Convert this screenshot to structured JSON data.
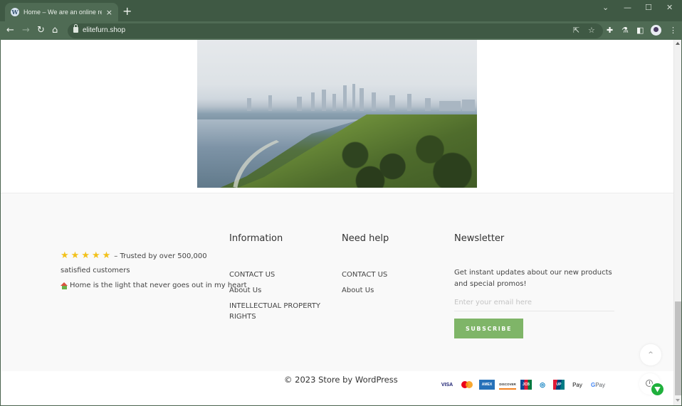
{
  "browser": {
    "tab": {
      "favicon": "wordpress-icon",
      "title": "Home – We are an online retail",
      "close_label": "×"
    },
    "new_tab_label": "+",
    "window_controls": {
      "tab_search": "⌄",
      "minimize": "—",
      "maximize": "☐",
      "close": "✕"
    },
    "nav": {
      "back": "←",
      "forward": "→",
      "reload": "↻",
      "home": "⌂"
    },
    "url": "elitefurn.shop",
    "omnibox_icons": {
      "share": "⇱",
      "bookmark": "☆"
    },
    "toolbar_icons": {
      "extensions": "✚",
      "labs": "⚗",
      "side_panel": "◧",
      "menu": "⋮"
    }
  },
  "hero_image": {
    "alt": "Aerial view of city skyline, lake, and park"
  },
  "footer": {
    "about": {
      "rating_stars": 5,
      "stars": [
        "★",
        "★",
        "★",
        "★",
        "★"
      ],
      "trust_line1": "– Trusted by over 500,000",
      "trust_line2": "satisfied customers",
      "motto": "Home is the light that never goes out in my heart"
    },
    "information": {
      "title": "Information",
      "links": [
        "CONTACT US",
        "About Us",
        "INTELLECTUAL PROPERTY",
        "RIGHTS"
      ]
    },
    "need_help": {
      "title": "Need help",
      "links": [
        "CONTACT US",
        "About Us"
      ]
    },
    "newsletter": {
      "title": "Newsletter",
      "description": "Get instant updates about our new products and special promos!",
      "email_placeholder": "Enter your email here",
      "email_value": "",
      "subscribe_label": "SUBSCRIBE"
    },
    "copyright": "© 2023 Store by WordPress",
    "payment_methods": [
      {
        "name": "visa",
        "label": "VISA"
      },
      {
        "name": "mastercard",
        "label": ""
      },
      {
        "name": "amex",
        "label": "AMEX"
      },
      {
        "name": "discover",
        "label": "DISCOVER"
      },
      {
        "name": "jcb",
        "label": "JCB"
      },
      {
        "name": "diners",
        "label": "◎"
      },
      {
        "name": "unionpay",
        "label": "UP"
      },
      {
        "name": "apple-pay",
        "label": " Pay"
      },
      {
        "name": "google-pay",
        "label_g": "G",
        "label": " Pay"
      }
    ],
    "scroll_top_label": "^"
  },
  "colors": {
    "browser_frame": "#4b634f",
    "accent_green": "#7fb568",
    "star_yellow": "#f2c11b",
    "chat_green": "#1fb03c"
  }
}
